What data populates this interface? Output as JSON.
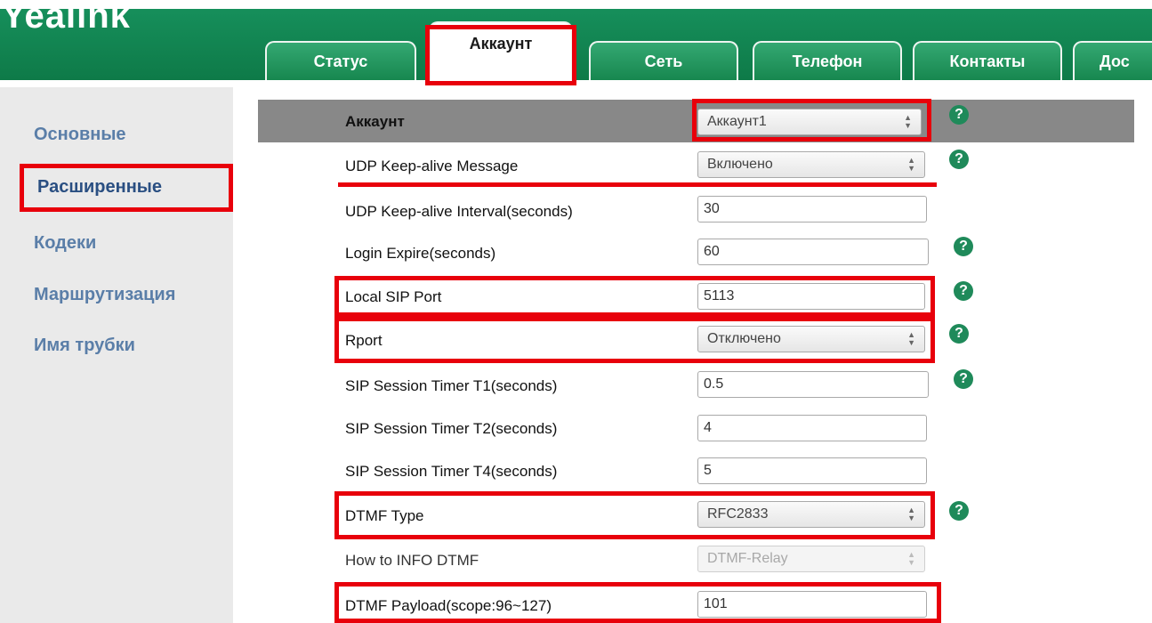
{
  "brand": {
    "logo": "Yealink"
  },
  "tabs": [
    {
      "label": "Статус"
    },
    {
      "label": "Аккаунт"
    },
    {
      "label": "Сеть"
    },
    {
      "label": "Телефон"
    },
    {
      "label": "Контакты"
    },
    {
      "label": "Дос"
    }
  ],
  "sidebar": {
    "items": [
      {
        "label": "Основные"
      },
      {
        "label": "Расширенные"
      },
      {
        "label": "Кодеки"
      },
      {
        "label": "Маршрутизация"
      },
      {
        "label": "Имя трубки"
      }
    ]
  },
  "form": {
    "account": {
      "label": "Аккаунт",
      "value": "Аккаунт1"
    },
    "udp_keepalive_message": {
      "label": "UDP Keep-alive Message",
      "value": "Включено"
    },
    "udp_keepalive_interval": {
      "label": "UDP Keep-alive Interval(seconds)",
      "value": "30"
    },
    "login_expire": {
      "label": "Login Expire(seconds)",
      "value": "60"
    },
    "local_sip_port": {
      "label": "Local SIP Port",
      "value": "5113"
    },
    "rport": {
      "label": "Rport",
      "value": "Отключено"
    },
    "timer_t1": {
      "label": "SIP Session Timer T1(seconds)",
      "value": "0.5"
    },
    "timer_t2": {
      "label": "SIP Session Timer T2(seconds)",
      "value": "4"
    },
    "timer_t4": {
      "label": "SIP Session Timer T4(seconds)",
      "value": "5"
    },
    "dtmf_type": {
      "label": "DTMF Type",
      "value": "RFC2833"
    },
    "info_dtmf": {
      "label": "How to INFO DTMF",
      "value": "DTMF-Relay"
    },
    "dtmf_payload": {
      "label": "DTMF Payload(scope:96~127)",
      "value": "101"
    }
  },
  "help_glyph": "?",
  "colors": {
    "header_green": "#0e7a48",
    "highlight_red": "#e8000b",
    "sidebar_active": "#2a4f82"
  }
}
